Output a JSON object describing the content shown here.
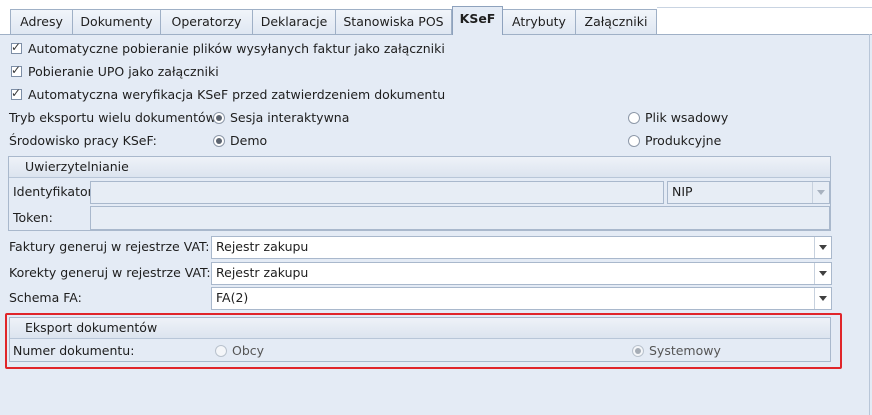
{
  "tabs": [
    {
      "label": "Adresy"
    },
    {
      "label": "Dokumenty"
    },
    {
      "label": "Operatorzy"
    },
    {
      "label": "Deklaracje"
    },
    {
      "label": "Stanowiska POS"
    },
    {
      "label": "KSeF",
      "active": true
    },
    {
      "label": "Atrybuty"
    },
    {
      "label": "Załączniki"
    }
  ],
  "options": {
    "auto_download": {
      "label": "Automatyczne pobieranie plików wysyłanych faktur jako załączniki",
      "checked": true
    },
    "upo_download": {
      "label": "Pobieranie UPO jako załączniki",
      "checked": true
    },
    "auto_verify": {
      "label": "Automatyczna weryfikacja KSeF przed zatwierdzeniem dokumentu",
      "checked": true
    }
  },
  "export_mode": {
    "label": "Tryb eksportu wielu dokumentów:",
    "option_interactive": "Sesja interaktywna",
    "option_batch": "Plik wsadowy",
    "selected": "Sesja interaktywna"
  },
  "environment": {
    "label": "Środowisko pracy KSeF:",
    "option_demo": "Demo",
    "option_production": "Produkcyjne",
    "selected": "Demo"
  },
  "auth": {
    "title": "Uwierzytelnianie",
    "identifier_label": "Identyfikator:",
    "identifier_value": "",
    "id_type": "NIP",
    "token_label": "Token:",
    "token_value": ""
  },
  "registers": {
    "invoices_label": "Faktury generuj w rejestrze VAT:",
    "invoices_value": "Rejestr zakupu",
    "corrections_label": "Korekty generuj w rejestrze VAT:",
    "corrections_value": "Rejestr zakupu",
    "schema_label": "Schema FA:",
    "schema_value": "FA(2)"
  },
  "export_docs": {
    "title": "Eksport dokumentów",
    "number_label": "Numer dokumentu:",
    "option_foreign": "Obcy",
    "option_system": "Systemowy",
    "selected": "Systemowy"
  },
  "colors": {
    "background": "#e4ebf5",
    "highlight_border": "#e0252a",
    "tab_border": "#9fb0c6"
  }
}
